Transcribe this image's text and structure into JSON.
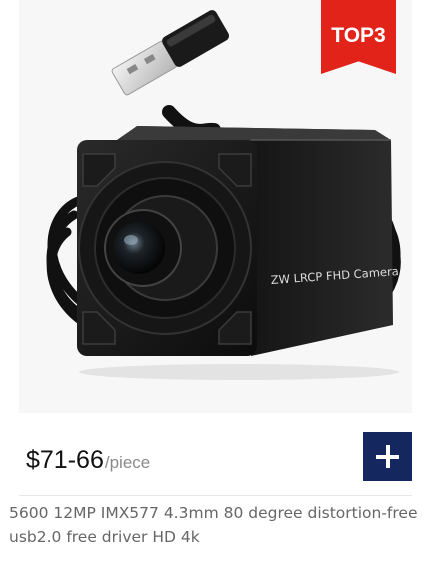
{
  "product": {
    "badge": "TOP3",
    "camera_label": "ZW LRCP FHD Camera",
    "price": "$71-66",
    "unit": "/piece",
    "description": "5600 12MP IMX577 4.3mm 80 degree distortion-free usb2.0 free driver HD 4k"
  },
  "colors": {
    "badge": "#e2231a",
    "add_button": "#14285f"
  },
  "icons": {
    "add": "plus-icon"
  }
}
